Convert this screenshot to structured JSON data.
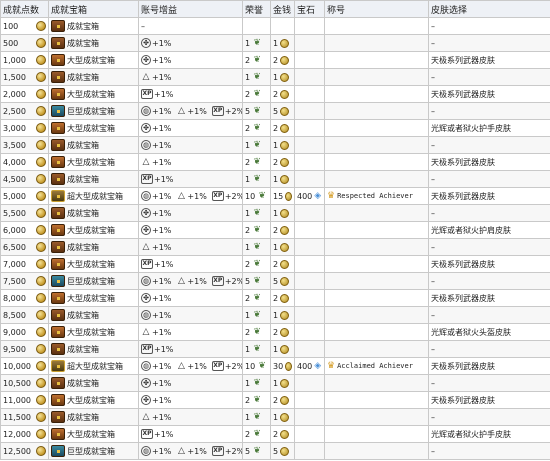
{
  "headers": [
    "成就点数",
    "成就宝箱",
    "账号增益",
    "荣誉",
    "金钱",
    "宝石",
    "称号",
    "皮肤选择"
  ],
  "rows": [
    {
      "points": "100",
      "chest_icon": "chest-icon",
      "chest": "成就宝箱",
      "buffs": [],
      "buff_text": "–",
      "honor": "",
      "gold": "",
      "gems": "",
      "title": "",
      "skin": "–"
    },
    {
      "points": "500",
      "chest_icon": "chest-icon",
      "chest": "成就宝箱",
      "buffs": [
        {
          "icon": "karma-icon",
          "v": "+1%"
        }
      ],
      "honor": "1",
      "gold": "1",
      "gems": "",
      "title": "",
      "skin": "–"
    },
    {
      "points": "1,000",
      "chest_icon": "large-chest-icon",
      "chest": "大型成就宝箱",
      "buffs": [
        {
          "icon": "karma-icon",
          "v": "+1%"
        }
      ],
      "honor": "2",
      "gold": "2",
      "gems": "",
      "title": "",
      "skin": "天极系列武器皮肤"
    },
    {
      "points": "1,500",
      "chest_icon": "chest-icon",
      "chest": "成就宝箱",
      "buffs": [
        {
          "icon": "gold-find-icon",
          "v": "+1%"
        }
      ],
      "honor": "1",
      "gold": "1",
      "gems": "",
      "title": "",
      "skin": "–"
    },
    {
      "points": "2,000",
      "chest_icon": "large-chest-icon",
      "chest": "大型成就宝箱",
      "buffs": [
        {
          "icon": "xp-icon",
          "v": "+1%"
        }
      ],
      "honor": "2",
      "gold": "2",
      "gems": "",
      "title": "",
      "skin": "天极系列武器皮肤"
    },
    {
      "points": "2,500",
      "chest_icon": "huge-chest-icon",
      "chest": "巨型成就宝箱",
      "buffs": [
        {
          "icon": "magic-find-icon",
          "v": "+1%"
        },
        {
          "icon": "gold-find-icon",
          "v": "+1%"
        },
        {
          "icon": "xp-icon",
          "v": "+2%"
        }
      ],
      "honor": "5",
      "gold": "5",
      "gems": "",
      "title": "",
      "skin": "–"
    },
    {
      "points": "3,000",
      "chest_icon": "large-chest-icon",
      "chest": "大型成就宝箱",
      "buffs": [
        {
          "icon": "karma-icon",
          "v": "+1%"
        }
      ],
      "honor": "2",
      "gold": "2",
      "gems": "",
      "title": "",
      "skin": "光辉或者狱火护手皮肤"
    },
    {
      "points": "3,500",
      "chest_icon": "chest-icon",
      "chest": "成就宝箱",
      "buffs": [
        {
          "icon": "magic-find-icon",
          "v": "+1%"
        }
      ],
      "honor": "1",
      "gold": "1",
      "gems": "",
      "title": "",
      "skin": "–"
    },
    {
      "points": "4,000",
      "chest_icon": "large-chest-icon",
      "chest": "大型成就宝箱",
      "buffs": [
        {
          "icon": "gold-find-icon",
          "v": "+1%"
        }
      ],
      "honor": "2",
      "gold": "2",
      "gems": "",
      "title": "",
      "skin": "天极系列武器皮肤"
    },
    {
      "points": "4,500",
      "chest_icon": "chest-icon",
      "chest": "成就宝箱",
      "buffs": [
        {
          "icon": "xp-icon",
          "v": "+1%"
        }
      ],
      "honor": "1",
      "gold": "1",
      "gems": "",
      "title": "",
      "skin": "–"
    },
    {
      "points": "5,000",
      "chest_icon": "super-chest-icon",
      "chest": "超大型成就宝箱",
      "buffs": [
        {
          "icon": "magic-find-icon",
          "v": "+1%"
        },
        {
          "icon": "gold-find-icon",
          "v": "+1%"
        },
        {
          "icon": "xp-icon",
          "v": "+2%"
        }
      ],
      "honor": "10",
      "gold": "15",
      "gems": "400",
      "title": "Respected Achiever",
      "skin": "天极系列武器皮肤"
    },
    {
      "points": "5,500",
      "chest_icon": "chest-icon",
      "chest": "成就宝箱",
      "buffs": [
        {
          "icon": "karma-icon",
          "v": "+1%"
        }
      ],
      "honor": "1",
      "gold": "1",
      "gems": "",
      "title": "",
      "skin": "–"
    },
    {
      "points": "6,000",
      "chest_icon": "large-chest-icon",
      "chest": "大型成就宝箱",
      "buffs": [
        {
          "icon": "karma-icon",
          "v": "+1%"
        }
      ],
      "honor": "2",
      "gold": "2",
      "gems": "",
      "title": "",
      "skin": "光辉或者狱火护肩皮肤"
    },
    {
      "points": "6,500",
      "chest_icon": "chest-icon",
      "chest": "成就宝箱",
      "buffs": [
        {
          "icon": "gold-find-icon",
          "v": "+1%"
        }
      ],
      "honor": "1",
      "gold": "1",
      "gems": "",
      "title": "",
      "skin": "–"
    },
    {
      "points": "7,000",
      "chest_icon": "large-chest-icon",
      "chest": "大型成就宝箱",
      "buffs": [
        {
          "icon": "xp-icon",
          "v": "+1%"
        }
      ],
      "honor": "2",
      "gold": "2",
      "gems": "",
      "title": "",
      "skin": "天极系列武器皮肤"
    },
    {
      "points": "7,500",
      "chest_icon": "huge-chest-icon",
      "chest": "巨型成就宝箱",
      "buffs": [
        {
          "icon": "magic-find-icon",
          "v": "+1%"
        },
        {
          "icon": "gold-find-icon",
          "v": "+1%"
        },
        {
          "icon": "xp-icon",
          "v": "+2%"
        }
      ],
      "honor": "5",
      "gold": "5",
      "gems": "",
      "title": "",
      "skin": "–"
    },
    {
      "points": "8,000",
      "chest_icon": "large-chest-icon",
      "chest": "大型成就宝箱",
      "buffs": [
        {
          "icon": "karma-icon",
          "v": "+1%"
        }
      ],
      "honor": "2",
      "gold": "2",
      "gems": "",
      "title": "",
      "skin": "天极系列武器皮肤"
    },
    {
      "points": "8,500",
      "chest_icon": "chest-icon",
      "chest": "成就宝箱",
      "buffs": [
        {
          "icon": "magic-find-icon",
          "v": "+1%"
        }
      ],
      "honor": "1",
      "gold": "1",
      "gems": "",
      "title": "",
      "skin": "–"
    },
    {
      "points": "9,000",
      "chest_icon": "large-chest-icon",
      "chest": "大型成就宝箱",
      "buffs": [
        {
          "icon": "gold-find-icon",
          "v": "+1%"
        }
      ],
      "honor": "2",
      "gold": "2",
      "gems": "",
      "title": "",
      "skin": "光辉或者狱火头盔皮肤"
    },
    {
      "points": "9,500",
      "chest_icon": "chest-icon",
      "chest": "成就宝箱",
      "buffs": [
        {
          "icon": "xp-icon",
          "v": "+1%"
        }
      ],
      "honor": "1",
      "gold": "1",
      "gems": "",
      "title": "",
      "skin": "–"
    },
    {
      "points": "10,000",
      "chest_icon": "super-chest-icon",
      "chest": "超大型成就宝箱",
      "buffs": [
        {
          "icon": "magic-find-icon",
          "v": "+1%"
        },
        {
          "icon": "gold-find-icon",
          "v": "+1%"
        },
        {
          "icon": "xp-icon",
          "v": "+2%"
        }
      ],
      "honor": "10",
      "gold": "30",
      "gems": "400",
      "title": "Acclaimed Achiever",
      "skin": "天极系列武器皮肤"
    },
    {
      "points": "10,500",
      "chest_icon": "chest-icon",
      "chest": "成就宝箱",
      "buffs": [
        {
          "icon": "karma-icon",
          "v": "+1%"
        }
      ],
      "honor": "1",
      "gold": "1",
      "gems": "",
      "title": "",
      "skin": "–"
    },
    {
      "points": "11,000",
      "chest_icon": "large-chest-icon",
      "chest": "大型成就宝箱",
      "buffs": [
        {
          "icon": "karma-icon",
          "v": "+1%"
        }
      ],
      "honor": "2",
      "gold": "2",
      "gems": "",
      "title": "",
      "skin": "天极系列武器皮肤"
    },
    {
      "points": "11,500",
      "chest_icon": "chest-icon",
      "chest": "成就宝箱",
      "buffs": [
        {
          "icon": "gold-find-icon",
          "v": "+1%"
        }
      ],
      "honor": "1",
      "gold": "1",
      "gems": "",
      "title": "",
      "skin": "–"
    },
    {
      "points": "12,000",
      "chest_icon": "large-chest-icon",
      "chest": "大型成就宝箱",
      "buffs": [
        {
          "icon": "xp-icon",
          "v": "+1%"
        }
      ],
      "honor": "2",
      "gold": "2",
      "gems": "",
      "title": "",
      "skin": "光辉或者狱火护手皮肤"
    },
    {
      "points": "12,500",
      "chest_icon": "huge-chest-icon",
      "chest": "巨型成就宝箱",
      "buffs": [
        {
          "icon": "magic-find-icon",
          "v": "+1%"
        },
        {
          "icon": "gold-find-icon",
          "v": "+1%"
        },
        {
          "icon": "xp-icon",
          "v": "+2%"
        }
      ],
      "honor": "5",
      "gold": "5",
      "gems": "",
      "title": "",
      "skin": "–"
    }
  ],
  "icons": {
    "karma-icon": "✤",
    "magic-find-icon": "◍",
    "gold-find-icon": "△",
    "xp-icon": "XP",
    "honor-icon": "❦",
    "gold-icon": "",
    "gem-icon": "◈",
    "title-icon": "♛"
  },
  "colors": {
    "header_bg": "#eef1f6",
    "border": "#c9c9c9",
    "gold": "#c79a2a",
    "gem": "#4a90d8"
  }
}
